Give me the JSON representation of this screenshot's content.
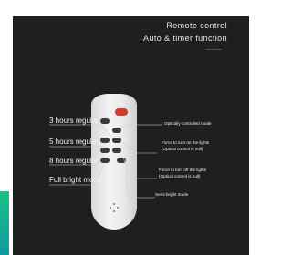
{
  "header": {
    "title_line1": "Remote control",
    "title_line2": "Auto & timer function"
  },
  "left_labels": [
    "3 hours regular",
    "5 hours regular",
    "8 hours regular",
    "Full bright mode"
  ],
  "right_labels": [
    "Optically controlled mode",
    "Force to turn on the lights",
    "(Optical control is null)",
    "Force to turn off the lights",
    "(Optical control is null)",
    "Semi-bright mode"
  ],
  "colors": {
    "panel": "#1f1f1f",
    "accent": "#1fbf86",
    "power_button": "#d23a2a"
  }
}
